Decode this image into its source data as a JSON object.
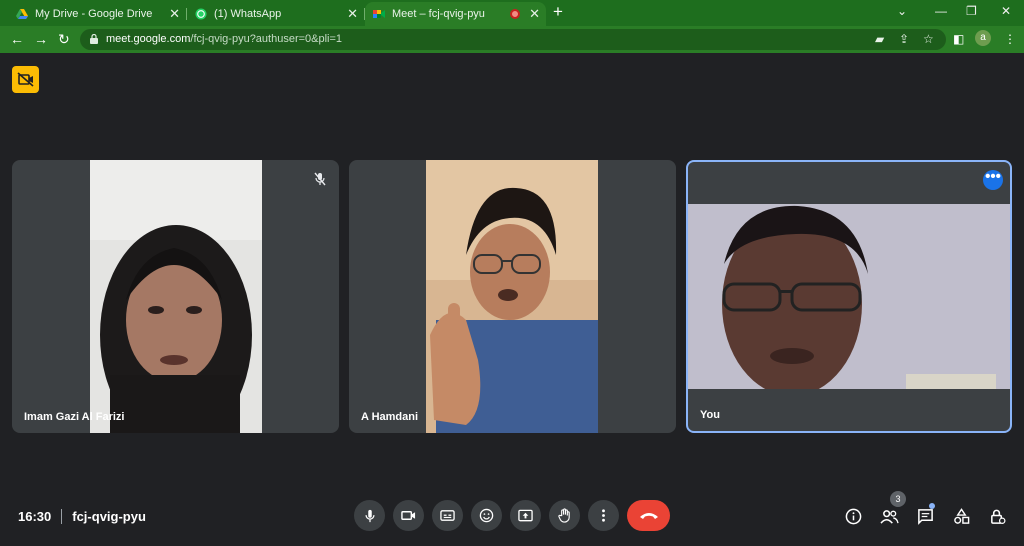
{
  "browser": {
    "tabs": [
      {
        "title": "My Drive - Google Drive",
        "icon": "google-drive-icon"
      },
      {
        "title": "(1) WhatsApp",
        "icon": "whatsapp-icon"
      },
      {
        "title": "Meet – fcj-qvig-pyu",
        "icon": "google-meet-icon",
        "recording": true,
        "active": true
      }
    ],
    "new_tab": "+",
    "url_host": "meet.google.com",
    "url_path": "/fcj-qvig-pyu?authuser=0&pli=1",
    "profile_initial": "a",
    "colors": {
      "frame": "#1e6e1e",
      "toolbar": "#2a7d26"
    }
  },
  "meet": {
    "participants": [
      {
        "name": "Imam Gazi Al Farizi",
        "muted": true
      },
      {
        "name": "A Hamdani",
        "muted": false
      },
      {
        "name": "You",
        "muted": false,
        "highlighted": true
      }
    ],
    "more_options_icon": "•••",
    "time": "16:30",
    "meeting_code": "fcj-qvig-pyu",
    "people_count": "3",
    "controls": [
      "mic-icon",
      "camera-icon",
      "captions-icon",
      "emoji-icon",
      "present-icon",
      "raise-hand-icon",
      "more-options-icon",
      "end-call-icon"
    ],
    "right_controls": [
      "info-icon",
      "people-icon",
      "chat-icon",
      "activities-icon",
      "host-controls-icon"
    ],
    "colors": {
      "background": "#202124",
      "tile": "#3c4043",
      "end_call": "#ea4335",
      "accent": "#8ab4f8"
    }
  }
}
